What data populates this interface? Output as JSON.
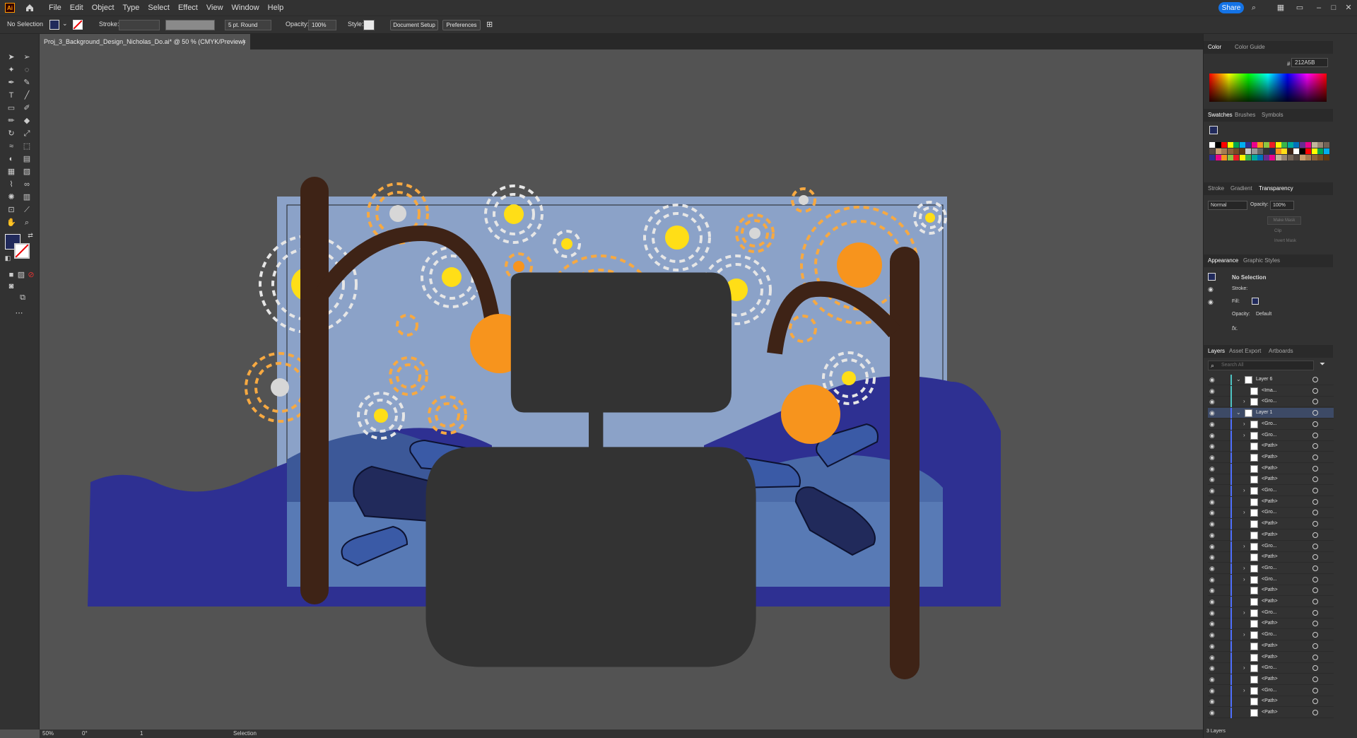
{
  "menubar": {
    "logo": "Ai",
    "items": [
      "File",
      "Edit",
      "Object",
      "Type",
      "Select",
      "Effect",
      "View",
      "Window",
      "Help"
    ],
    "share": "Share"
  },
  "control": {
    "selection": "No Selection",
    "stroke_label": "Stroke:",
    "brush": "5 pt. Round",
    "opacity_label": "Opacity:",
    "opacity_value": "100%",
    "style_label": "Style:",
    "document_setup": "Document Setup",
    "preferences": "Preferences"
  },
  "document": {
    "tab_title": "Proj_3_Background_Design_Nicholas_Do.ai* @ 50 % (CMYK/Preview)",
    "close": "×"
  },
  "status": {
    "zoom": "50%",
    "rotation": "0°",
    "artboard": "1",
    "tool": "Selection"
  },
  "color_panel": {
    "tabs": [
      "Color",
      "Color Guide"
    ],
    "hex_symbol": "#",
    "hex": "212A5B"
  },
  "swatches_panel": {
    "tabs": [
      "Swatches",
      "Brushes",
      "Symbols"
    ]
  },
  "transparency_panel": {
    "tabs": [
      "Stroke",
      "Gradient",
      "Transparency"
    ],
    "blend_mode": "Normal",
    "opacity_label": "Opacity:",
    "opacity_value": "100%",
    "make_mask": "Make Mask",
    "clip": "Clip",
    "invert_mask": "Invert Mask"
  },
  "appearance_panel": {
    "tabs": [
      "Appearance",
      "Graphic Styles"
    ],
    "title": "No Selection",
    "stroke": "Stroke:",
    "fill": "Fill:",
    "opacity": "Opacity:",
    "opacity_value": "Default",
    "fx": "fx."
  },
  "layers_panel": {
    "tabs": [
      "Layers",
      "Asset Export",
      "Artboards"
    ],
    "search_placeholder": "Search All",
    "rows": [
      {
        "label": "Layer 6",
        "type": "layer",
        "color": "#4fc3c3",
        "expanded": true
      },
      {
        "label": "<Ima...",
        "type": "item",
        "color": "#4fc3c3",
        "expanded": false
      },
      {
        "label": "<Gro...",
        "type": "group",
        "color": "#4fc3c3",
        "expanded": false
      },
      {
        "label": "Layer 1",
        "type": "layer",
        "color": "#4f6fff",
        "expanded": true
      },
      {
        "label": "<Gro...",
        "type": "group",
        "color": "#4f6fff",
        "expanded": false
      },
      {
        "label": "<Gro...",
        "type": "group",
        "color": "#4f6fff",
        "expanded": false
      },
      {
        "label": "<Path>",
        "type": "item",
        "color": "#4f6fff",
        "expanded": false
      },
      {
        "label": "<Path>",
        "type": "item",
        "color": "#4f6fff",
        "expanded": false
      },
      {
        "label": "<Path>",
        "type": "item",
        "color": "#4f6fff",
        "expanded": false
      },
      {
        "label": "<Path>",
        "type": "item",
        "color": "#4f6fff",
        "expanded": false
      },
      {
        "label": "<Gro...",
        "type": "group",
        "color": "#4f6fff",
        "expanded": false
      },
      {
        "label": "<Path>",
        "type": "item",
        "color": "#4f6fff",
        "expanded": false
      },
      {
        "label": "<Gro...",
        "type": "group",
        "color": "#4f6fff",
        "expanded": false
      },
      {
        "label": "<Path>",
        "type": "item",
        "color": "#4f6fff",
        "expanded": false
      },
      {
        "label": "<Path>",
        "type": "item",
        "color": "#4f6fff",
        "expanded": false
      },
      {
        "label": "<Gro...",
        "type": "group",
        "color": "#4f6fff",
        "expanded": false
      },
      {
        "label": "<Path>",
        "type": "item",
        "color": "#4f6fff",
        "expanded": false
      },
      {
        "label": "<Gro...",
        "type": "group",
        "color": "#4f6fff",
        "expanded": false
      },
      {
        "label": "<Gro...",
        "type": "group",
        "color": "#4f6fff",
        "expanded": false
      },
      {
        "label": "<Path>",
        "type": "item",
        "color": "#4f6fff",
        "expanded": false
      },
      {
        "label": "<Path>",
        "type": "item",
        "color": "#4f6fff",
        "expanded": false
      },
      {
        "label": "<Gro...",
        "type": "group",
        "color": "#4f6fff",
        "expanded": false
      },
      {
        "label": "<Path>",
        "type": "item",
        "color": "#4f6fff",
        "expanded": false
      },
      {
        "label": "<Gro...",
        "type": "group",
        "color": "#4f6fff",
        "expanded": false
      },
      {
        "label": "<Path>",
        "type": "item",
        "color": "#4f6fff",
        "expanded": false
      },
      {
        "label": "<Path>",
        "type": "item",
        "color": "#4f6fff",
        "expanded": false
      },
      {
        "label": "<Gro...",
        "type": "group",
        "color": "#4f6fff",
        "expanded": false
      },
      {
        "label": "<Path>",
        "type": "item",
        "color": "#4f6fff",
        "expanded": false
      },
      {
        "label": "<Gro...",
        "type": "group",
        "color": "#4f6fff",
        "expanded": false
      },
      {
        "label": "<Path>",
        "type": "item",
        "color": "#4f6fff",
        "expanded": false
      },
      {
        "label": "<Path>",
        "type": "item",
        "color": "#4f6fff",
        "expanded": false
      }
    ],
    "footer": "3 Layers"
  },
  "colors": {
    "accent": "#1473e6",
    "sky": "#8ba2c8",
    "navy": "#2e3092",
    "dark_navy": "#212a5b",
    "orange": "#f7941d",
    "yellow": "#ffde17",
    "brown": "#3e2316",
    "blob": "#333333"
  }
}
